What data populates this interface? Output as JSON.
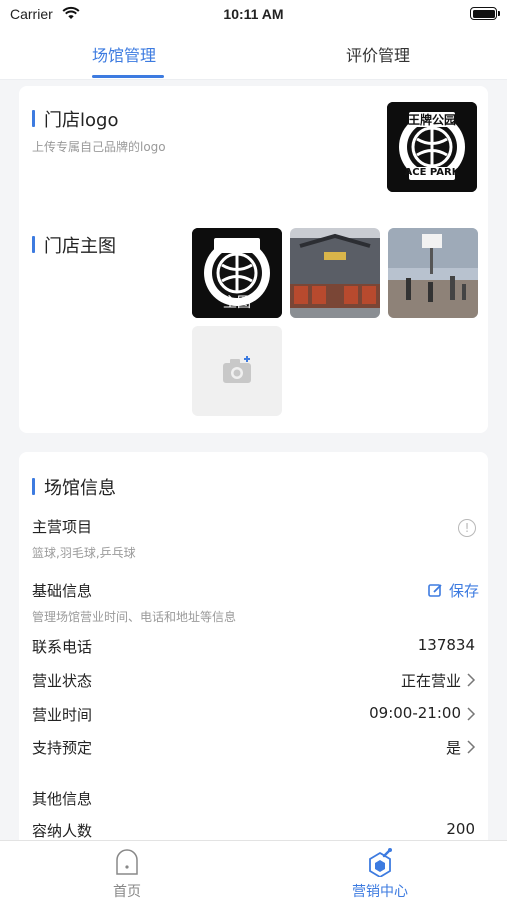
{
  "status": {
    "carrier": "Carrier",
    "time": "10:11 AM"
  },
  "tabs": [
    {
      "label": "场馆管理",
      "active": true
    },
    {
      "label": "评价管理",
      "active": false
    }
  ],
  "store": {
    "logo_title": "门店logo",
    "logo_sub": "上传专属自己品牌的logo",
    "main_image_title": "门店主图",
    "main_image_badge": "主图",
    "logo_text_top": "王牌公园",
    "logo_text_bottom": "ACE PARK"
  },
  "venue": {
    "title": "场馆信息",
    "main_items_label": "主营项目",
    "main_items_value": "篮球,羽毛球,乒乓球",
    "basic_label": "基础信息",
    "basic_sub": "管理场馆营业时间、电话和地址等信息",
    "save_label": "保存",
    "rows": [
      {
        "label": "联系电话",
        "value": "137834",
        "chevron": false
      },
      {
        "label": "营业状态",
        "value": "正在营业",
        "chevron": true
      },
      {
        "label": "营业时间",
        "value": "09:00-21:00",
        "chevron": true
      },
      {
        "label": "支持预定",
        "value": "是",
        "chevron": true
      }
    ],
    "other_title": "其他信息",
    "capacity_label": "容纳人数",
    "capacity_value": "200"
  },
  "nav": [
    {
      "label": "首页",
      "active": false,
      "icon": "home-icon"
    },
    {
      "label": "营销中心",
      "active": true,
      "icon": "marketing-icon"
    }
  ],
  "colors": {
    "accent": "#3d7be0",
    "background": "#f4f5f7"
  }
}
